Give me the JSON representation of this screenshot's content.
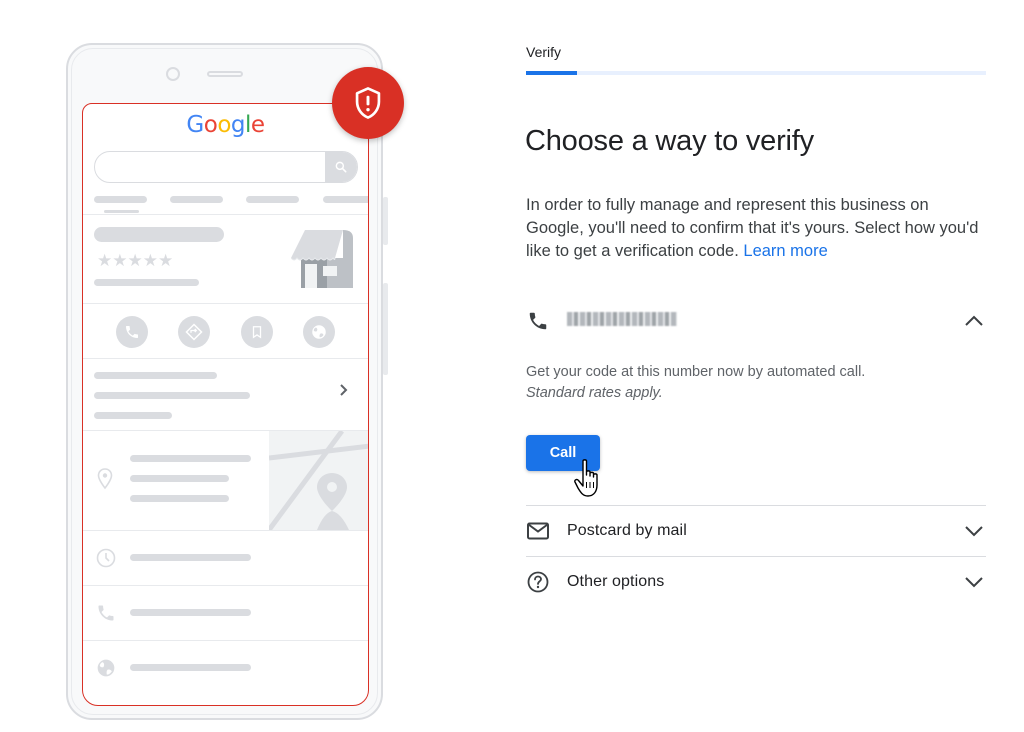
{
  "illustration": {
    "logo_letters": [
      {
        "ch": "G",
        "color": "#4285f4"
      },
      {
        "ch": "o",
        "color": "#ea4335"
      },
      {
        "ch": "o",
        "color": "#fbbc05"
      },
      {
        "ch": "g",
        "color": "#4285f4"
      },
      {
        "ch": "l",
        "color": "#34a853"
      },
      {
        "ch": "e",
        "color": "#ea4335"
      }
    ],
    "rating_stars": "★★★★★",
    "badge_icon": "shield-alert-icon",
    "chevron": "›"
  },
  "header": {
    "step_label": "Verify",
    "progress_fraction": 0.11
  },
  "main": {
    "title": "Choose a way to verify",
    "description": "In order to fully manage and represent this business on Google, you'll need to confirm that it's yours. Select how you'd like to get a verification code.",
    "learn_more": "Learn more"
  },
  "options": [
    {
      "id": "phone",
      "icon": "phone-icon",
      "label_redacted": true,
      "expanded": true,
      "detail": "Get your code at this number now by automated call.",
      "detail_note": "Standard rates apply.",
      "button": "Call"
    },
    {
      "id": "postcard",
      "icon": "mail-icon",
      "label": "Postcard by mail",
      "expanded": false
    },
    {
      "id": "other",
      "icon": "help-circle-icon",
      "label": "Other options",
      "expanded": false
    }
  ],
  "colors": {
    "accent": "#1a73e8",
    "alert": "#d93025",
    "text": "#202124",
    "secondary_text": "#5f6368"
  }
}
